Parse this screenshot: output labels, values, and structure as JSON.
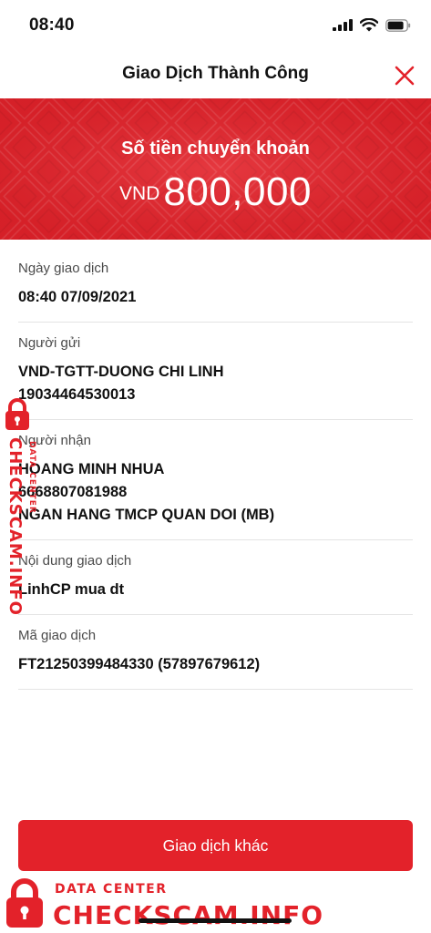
{
  "status_bar": {
    "time": "08:40"
  },
  "header": {
    "title": "Giao Dịch Thành Công"
  },
  "banner": {
    "label": "Số tiền chuyển khoản",
    "currency": "VND",
    "amount": "800,000"
  },
  "details": {
    "date": {
      "label": "Ngày giao dịch",
      "value": "08:40 07/09/2021"
    },
    "sender": {
      "label": "Người gửi",
      "name": "VND-TGTT-DUONG CHI LINH",
      "account": "19034464530013"
    },
    "recipient": {
      "label": "Người nhận",
      "name": "HOANG MINH NHUA",
      "account": "6668807081988",
      "bank": "NGAN HANG TMCP QUAN DOI (MB)"
    },
    "content": {
      "label": "Nội dung giao dịch",
      "value": "LinhCP mua dt"
    },
    "code": {
      "label": "Mã giao dịch",
      "value": "FT21250399484330 (57897679612)"
    }
  },
  "actions": {
    "other_transaction": "Giao dịch khác"
  },
  "watermark": {
    "brand": "CHECKSCAM.INFO",
    "tagline": "DATA CENTER"
  },
  "colors": {
    "brand_red": "#e3222a"
  }
}
